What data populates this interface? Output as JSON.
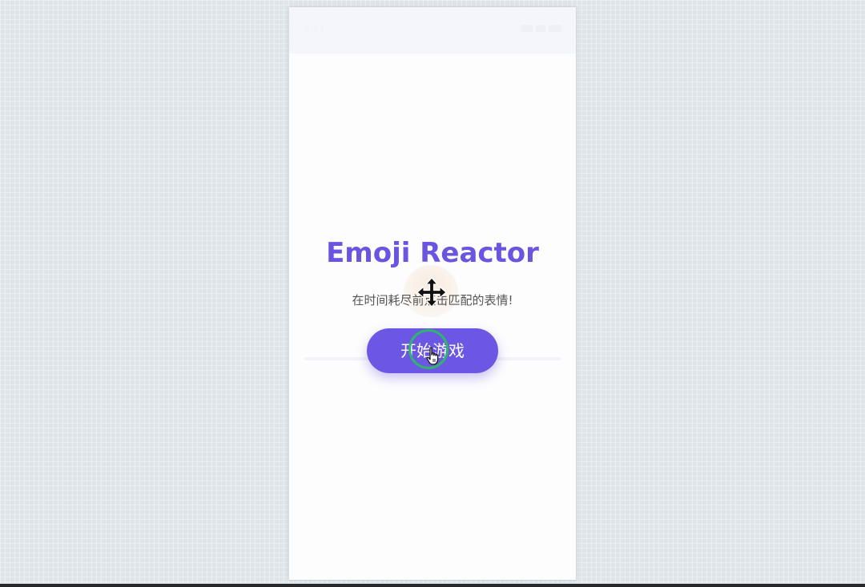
{
  "status_bar": {
    "time": "9:41"
  },
  "game": {
    "title": "Emoji Reactor",
    "subtitle": "在时间耗尽前点击匹配的表情!",
    "start_button_label": "开始游戏"
  },
  "colors": {
    "accent": "#6b57e3",
    "title": "#6a55e0",
    "click_indicator": "#2fb36d",
    "background": "#dde5ea"
  },
  "icons": {
    "drag": "move-cursor-icon",
    "pointer": "hand-pointer-icon"
  }
}
